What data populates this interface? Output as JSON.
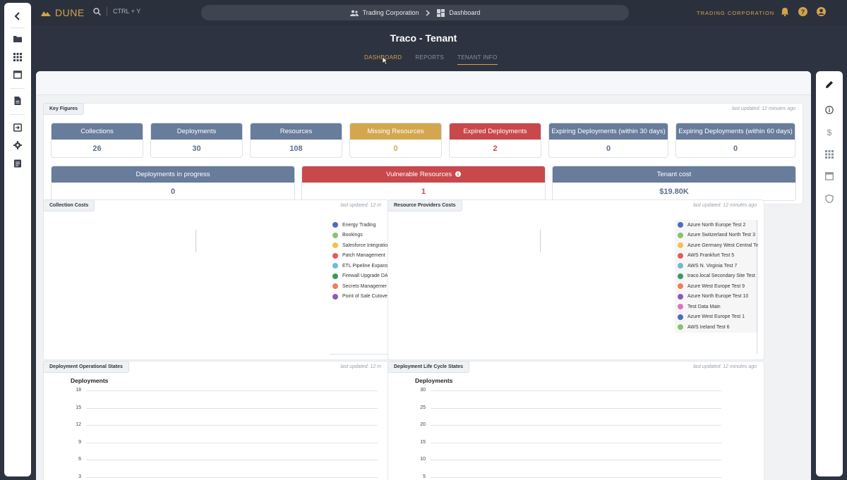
{
  "app": {
    "logo": "DUNE",
    "search_shortcut": "CTRL + Y",
    "tenant_label": "TRADING CORPORATION"
  },
  "breadcrumb": {
    "tenant": "Trading Corporation",
    "page": "Dashboard"
  },
  "page": {
    "title": "Traco - Tenant"
  },
  "tabs": [
    {
      "label": "DASHBOARD"
    },
    {
      "label": "REPORTS"
    },
    {
      "label": "TENANT INFO"
    }
  ],
  "key_figures": {
    "title": "Key Figures",
    "updated": "last updated: 12 minutes ago",
    "items": [
      {
        "label": "Collections",
        "value": "26"
      },
      {
        "label": "Deployments",
        "value": "30"
      },
      {
        "label": "Resources",
        "value": "108"
      },
      {
        "label": "Missing Resources",
        "value": "0"
      },
      {
        "label": "Expired Deployments",
        "value": "2"
      },
      {
        "label": "Expiring Deployments (within 30 days)",
        "value": "0"
      },
      {
        "label": "Expiring Deployments (within 60 days)",
        "value": "0"
      },
      {
        "label": "Deployments in progress",
        "value": "0"
      },
      {
        "label": "Vulnerable Resources",
        "value": "1"
      },
      {
        "label": "Tenant cost",
        "value": "$19.80K"
      }
    ]
  },
  "collection_costs": {
    "title": "Collection Costs",
    "updated": "last updated: 12 m",
    "legend": [
      {
        "name": "Energy Trading",
        "color": "#4f6bbd"
      },
      {
        "name": "Bookings",
        "color": "#8cc26a"
      },
      {
        "name": "Salesforce Integratio",
        "color": "#f2c14e"
      },
      {
        "name": "Patch Management",
        "color": "#e25c5c"
      },
      {
        "name": "ETL Pipeline Expans",
        "color": "#6bbcd8"
      },
      {
        "name": "Firewall Upgrade DA",
        "color": "#3a9a5e"
      },
      {
        "name": "Secrets Managemer",
        "color": "#f07f55"
      },
      {
        "name": "Point of Sale Cutove",
        "color": "#8e59b8"
      }
    ]
  },
  "provider_costs": {
    "title": "Resource Providers Costs",
    "updated": "last updated: 12 minutes ago",
    "legend": [
      {
        "name": "Azure North Europe Test 2",
        "color": "#4f6bbd"
      },
      {
        "name": "Azure Switzerland North Test 3",
        "color": "#8cc26a"
      },
      {
        "name": "Azure Germany West Central Te",
        "color": "#f2c14e"
      },
      {
        "name": "AWS Frankfurt Test 5",
        "color": "#e25c5c"
      },
      {
        "name": "AWS N. Virginia Test 7",
        "color": "#6bbcd8"
      },
      {
        "name": "traco.local Secondary Site Test",
        "color": "#3a9a5e"
      },
      {
        "name": "Azure West Europe Test 9",
        "color": "#f07f55"
      },
      {
        "name": "Azure North Europe Test 10",
        "color": "#8e59b8"
      },
      {
        "name": "Test Data Main",
        "color": "#e071c6"
      },
      {
        "name": "Azure West Europe Test 1",
        "color": "#4f6bbd"
      },
      {
        "name": "AWS Ireland Test 6",
        "color": "#8cc26a"
      }
    ]
  },
  "op_states": {
    "title": "Deployment Operational States",
    "updated": "last updated: 12 m",
    "ylabel": "Deployments",
    "ticks": [
      "18",
      "15",
      "12",
      "9",
      "6",
      "3"
    ]
  },
  "lifecycle": {
    "title": "Deployment Life Cycle States",
    "updated": "last updated: 12 minutes ago",
    "ylabel": "Deployments",
    "ticks": [
      "30",
      "25",
      "20",
      "15",
      "10",
      "5"
    ]
  },
  "colors": {
    "slate": "#687c9b",
    "gold": "#d3a74f",
    "red": "#c9484b",
    "navy": "#4a5f7e"
  }
}
